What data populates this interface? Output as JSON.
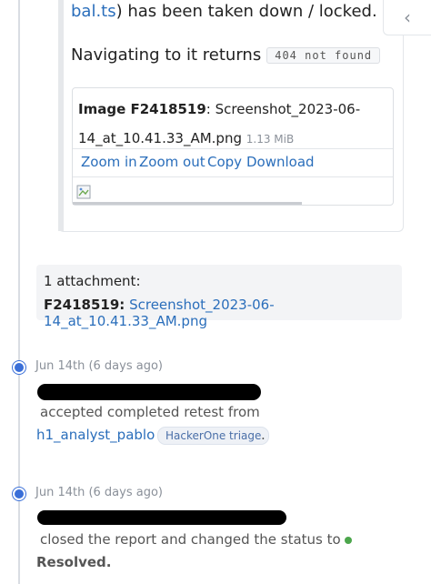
{
  "report_excerpt": {
    "line1_link": "bal.ts",
    "line1_rest": ") has been taken down / locked.",
    "line2_text": "Navigating to it returns",
    "line2_code": "404 not found",
    "image": {
      "label": "Image F2418519",
      "filename": ": Screenshot_2023-06-14_at_10.41.33_AM.png",
      "size": "1.13 MiB",
      "actions": {
        "zoom_in": "Zoom in",
        "zoom_out": "Zoom out",
        "copy": "Copy",
        "download": "Download"
      }
    }
  },
  "attachments": {
    "count_label": "1 attachment:",
    "items": [
      {
        "id": "F2418519:",
        "name": "Screenshot_2023-06-14_at_10.41.33_AM.png"
      }
    ]
  },
  "timeline": [
    {
      "date": "Jun 14th (6 days ago)",
      "action": "accepted completed retest from",
      "target_user": "h1_analyst_pablo",
      "badge": "HackerOne triage",
      "suffix": "."
    },
    {
      "date": "Jun 14th (6 days ago)",
      "action": "closed the report and changed the status to",
      "status": "Resolved.",
      "status_color": "#4ca64c"
    }
  ],
  "colors": {
    "link": "#2a6ebb",
    "timeline_dot": "#3a6fd8"
  }
}
